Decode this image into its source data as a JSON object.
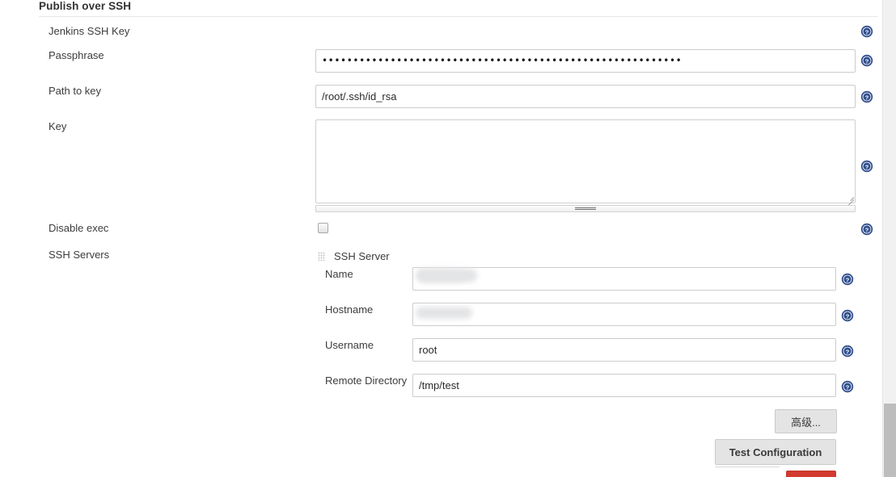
{
  "section": {
    "title": "Publish over SSH"
  },
  "fields": {
    "jenkins_ssh_key_label": "Jenkins SSH Key",
    "passphrase_label": "Passphrase",
    "passphrase_value": "••••••••••••••••••••••••••••••••••••••••••••••••••••••••••",
    "path_to_key_label": "Path to key",
    "path_to_key_value": "/root/.ssh/id_rsa",
    "key_label": "Key",
    "key_value": "",
    "disable_exec_label": "Disable exec",
    "disable_exec_checked": false,
    "ssh_servers_label": "SSH Servers"
  },
  "server": {
    "block_title": "SSH Server",
    "name_label": "Name",
    "name_value": "",
    "hostname_label": "Hostname",
    "hostname_value": "",
    "username_label": "Username",
    "username_value": "root",
    "remote_directory_label": "Remote Directory",
    "remote_directory_value": "/tmp/test"
  },
  "buttons": {
    "advanced": "高级...",
    "test_configuration": "Test Configuration",
    "delete": ""
  },
  "icons": {
    "help": "help-icon",
    "drag_grip": "drag-grip-icon"
  },
  "colors": {
    "help_blue": "#32508e",
    "button_gray": "#e4e4e4",
    "danger_red": "#d2392f",
    "heading": "#333333"
  }
}
